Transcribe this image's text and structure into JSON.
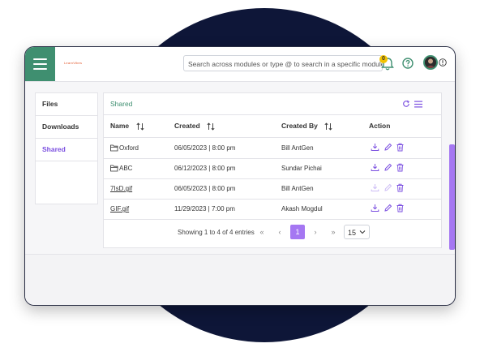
{
  "header": {
    "logo_text": "LearnVibes",
    "search_placeholder": "Search across modules or type @ to search in a specific module",
    "notification_count": "0"
  },
  "sidebar": {
    "items": [
      {
        "label": "Files"
      },
      {
        "label": "Downloads"
      },
      {
        "label": "Shared"
      }
    ],
    "active": "Shared"
  },
  "panel": {
    "title": "Shared"
  },
  "table": {
    "columns": [
      "Name",
      "Created",
      "Created By",
      "Action"
    ],
    "rows": [
      {
        "name": "Oxford",
        "type": "folder",
        "created": "06/05/2023 | 8:00 pm",
        "created_by": "Bill AntGen"
      },
      {
        "name": "ABC",
        "type": "folder",
        "created": "06/12/2023 | 8:00 pm",
        "created_by": "Sundar Pichai"
      },
      {
        "name": "7IsD.gif",
        "type": "file",
        "created": "06/05/2023 | 8:00 pm",
        "created_by": "Bill AntGen"
      },
      {
        "name": "GIF.gif",
        "type": "file",
        "created": "11/29/2023 | 7:00 pm",
        "created_by": "Akash Mogdul"
      }
    ]
  },
  "pagination": {
    "summary": "Showing 1 to 4 of 4 entries",
    "current_page": "1",
    "page_size": "15"
  },
  "colors": {
    "brand_green": "#3f8f70",
    "accent_purple": "#a577f2",
    "backdrop_navy": "#0e1638"
  }
}
